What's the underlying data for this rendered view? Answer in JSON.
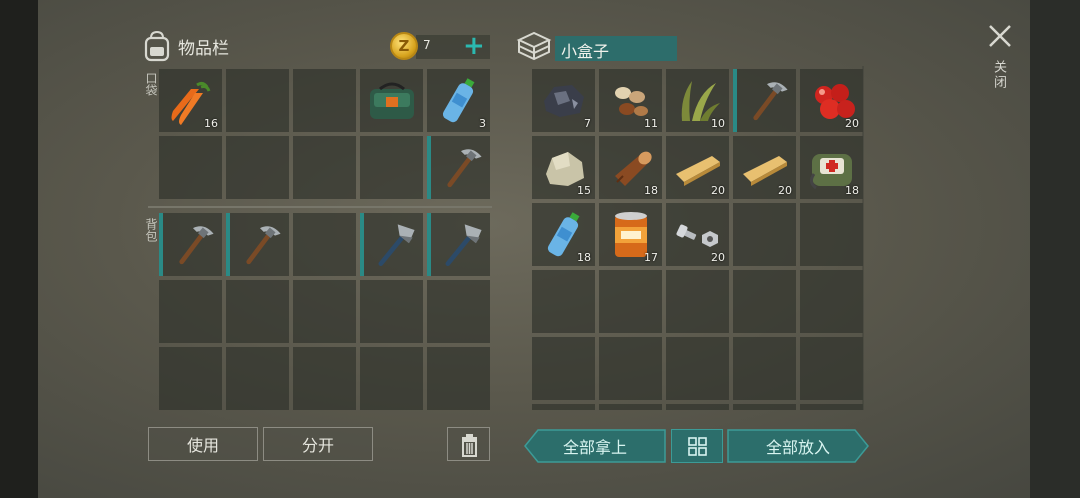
{
  "inventory": {
    "title": "物品栏",
    "coins": "7",
    "pocket_label": "口袋",
    "backpack_label": "背包",
    "pocket_slots": [
      {
        "icon": "carrot-icon",
        "qty": "16",
        "equipped": false
      },
      {
        "icon": "",
        "qty": "",
        "equipped": false
      },
      {
        "icon": "",
        "qty": "",
        "equipped": false
      },
      {
        "icon": "green-bag-icon",
        "qty": "",
        "equipped": false
      },
      {
        "icon": "water-bottle-icon",
        "qty": "3",
        "equipped": false
      },
      {
        "icon": "",
        "qty": "",
        "equipped": false
      },
      {
        "icon": "",
        "qty": "",
        "equipped": false
      },
      {
        "icon": "",
        "qty": "",
        "equipped": false
      },
      {
        "icon": "",
        "qty": "",
        "equipped": false
      },
      {
        "icon": "pickaxe-icon",
        "qty": "",
        "equipped": true
      }
    ],
    "backpack_slots": [
      {
        "icon": "pickaxe-icon",
        "qty": "",
        "equipped": true
      },
      {
        "icon": "pickaxe-icon",
        "qty": "",
        "equipped": true
      },
      {
        "icon": "",
        "qty": "",
        "equipped": false
      },
      {
        "icon": "hatchet-icon",
        "qty": "",
        "equipped": true
      },
      {
        "icon": "hatchet-icon",
        "qty": "",
        "equipped": true
      },
      {
        "icon": "",
        "qty": "",
        "equipped": false
      },
      {
        "icon": "",
        "qty": "",
        "equipped": false
      },
      {
        "icon": "",
        "qty": "",
        "equipped": false
      },
      {
        "icon": "",
        "qty": "",
        "equipped": false
      },
      {
        "icon": "",
        "qty": "",
        "equipped": false
      },
      {
        "icon": "",
        "qty": "",
        "equipped": false
      },
      {
        "icon": "",
        "qty": "",
        "equipped": false
      },
      {
        "icon": "",
        "qty": "",
        "equipped": false
      },
      {
        "icon": "",
        "qty": "",
        "equipped": false
      },
      {
        "icon": "",
        "qty": "",
        "equipped": false
      }
    ]
  },
  "container": {
    "name": "小盒子",
    "slots": [
      {
        "icon": "iron-ore-icon",
        "qty": "7",
        "equipped": false
      },
      {
        "icon": "seeds-icon",
        "qty": "11",
        "equipped": false
      },
      {
        "icon": "plant-fiber-icon",
        "qty": "10",
        "equipped": false
      },
      {
        "icon": "pickaxe-icon",
        "qty": "",
        "equipped": true
      },
      {
        "icon": "berries-icon",
        "qty": "20",
        "equipped": false
      },
      {
        "icon": "stone-icon",
        "qty": "15",
        "equipped": false
      },
      {
        "icon": "log-icon",
        "qty": "18",
        "equipped": false
      },
      {
        "icon": "plank-icon",
        "qty": "20",
        "equipped": false
      },
      {
        "icon": "plank-icon",
        "qty": "20",
        "equipped": false
      },
      {
        "icon": "medkit-bag-icon",
        "qty": "18",
        "equipped": false
      },
      {
        "icon": "water-bottle-icon",
        "qty": "18",
        "equipped": false
      },
      {
        "icon": "canned-food-icon",
        "qty": "17",
        "equipped": false
      },
      {
        "icon": "nuts-bolts-icon",
        "qty": "20",
        "equipped": false
      },
      {
        "icon": "",
        "qty": "",
        "equipped": false
      },
      {
        "icon": "",
        "qty": "",
        "equipped": false
      },
      {
        "icon": "",
        "qty": "",
        "equipped": false
      },
      {
        "icon": "",
        "qty": "",
        "equipped": false
      },
      {
        "icon": "",
        "qty": "",
        "equipped": false
      },
      {
        "icon": "",
        "qty": "",
        "equipped": false
      },
      {
        "icon": "",
        "qty": "",
        "equipped": false
      },
      {
        "icon": "",
        "qty": "",
        "equipped": false
      },
      {
        "icon": "",
        "qty": "",
        "equipped": false
      },
      {
        "icon": "",
        "qty": "",
        "equipped": false
      },
      {
        "icon": "",
        "qty": "",
        "equipped": false
      },
      {
        "icon": "",
        "qty": "",
        "equipped": false
      },
      {
        "icon": "",
        "qty": "",
        "equipped": false
      },
      {
        "icon": "",
        "qty": "",
        "equipped": false
      },
      {
        "icon": "",
        "qty": "",
        "equipped": false
      },
      {
        "icon": "",
        "qty": "",
        "equipped": false
      },
      {
        "icon": "",
        "qty": "",
        "equipped": false
      }
    ]
  },
  "buttons": {
    "use": "使用",
    "split": "分开",
    "take_all": "全部拿上",
    "put_all": "全部放入",
    "close": "关闭"
  },
  "colors": {
    "accent": "#2a8a86",
    "teal_button": "#2c6e6b"
  }
}
